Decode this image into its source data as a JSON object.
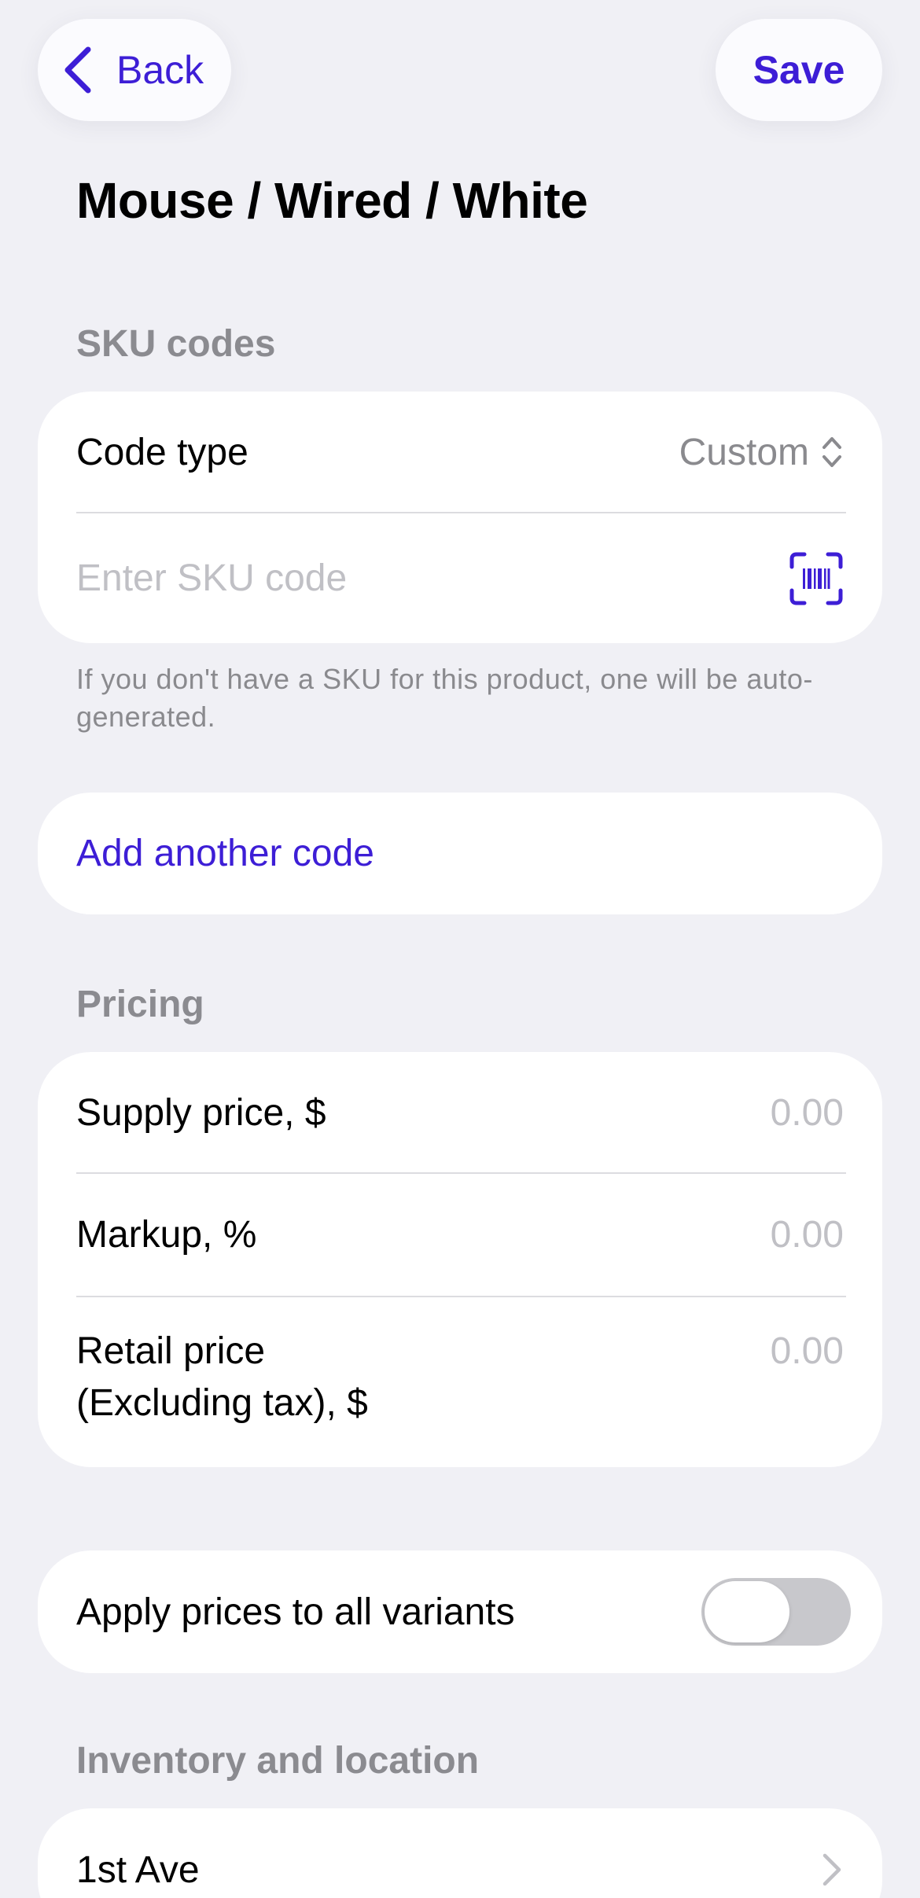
{
  "nav": {
    "back_label": "Back",
    "save_label": "Save",
    "accent_color": "#3d1ed6"
  },
  "page_title": "Mouse / Wired / White",
  "sku": {
    "section_label": "SKU codes",
    "code_type_label": "Code type",
    "code_type_value": "Custom",
    "sku_placeholder": "Enter SKU code",
    "helper_text": "If you don't have a SKU for this product, one will be auto-generated.",
    "add_code_label": "Add another code"
  },
  "pricing": {
    "section_label": "Pricing",
    "supply_price_label": "Supply price, $",
    "supply_price_value": "0.00",
    "markup_label": "Markup, %",
    "markup_value": "0.00",
    "retail_price_label_line1": "Retail price",
    "retail_price_label_line2": "(Excluding tax), $",
    "retail_price_value": "0.00"
  },
  "apply_prices": {
    "label": "Apply prices to all variants",
    "enabled": false
  },
  "inventory": {
    "section_label": "Inventory and location",
    "location_label": "1st Ave"
  },
  "icons": {
    "back": "chevron-left-icon",
    "picker": "chevron-up-down-icon",
    "scan": "barcode-scan-icon",
    "location": "chevron-right-icon"
  }
}
